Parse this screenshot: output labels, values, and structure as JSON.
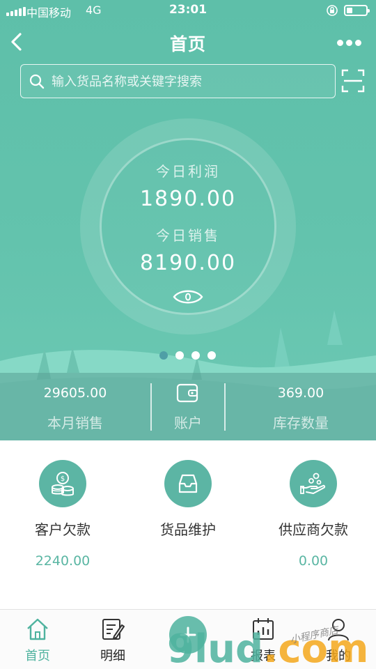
{
  "status_bar": {
    "carrier": "中国移动",
    "network": "4G",
    "time": "23:01",
    "battery_level": 0.3
  },
  "nav": {
    "title": "首页",
    "back_icon": "chevron-left-icon",
    "more_icon": "more-dots-icon"
  },
  "search": {
    "placeholder": "输入货品名称或关键字搜索",
    "scan_icon": "scan-icon"
  },
  "hero": {
    "profit_label": "今日利润",
    "profit_value": "1890.00",
    "sales_label": "今日销售",
    "sales_value": "8190.00",
    "visibility_icon": "eye-icon",
    "carousel": {
      "count": 4,
      "active_index": 0
    }
  },
  "summary": {
    "monthly_sales_value": "29605.00",
    "monthly_sales_label": "本月销售",
    "account_label": "账户",
    "stock_value": "369.00",
    "stock_label": "库存数量"
  },
  "actions": [
    {
      "label": "客户欠款",
      "amount": "2240.00",
      "icon": "coins-icon"
    },
    {
      "label": "货品维护",
      "amount": "",
      "icon": "inbox-icon"
    },
    {
      "label": "供应商欠款",
      "amount": "0.00",
      "icon": "hand-coins-icon"
    }
  ],
  "tabbar": {
    "items": [
      {
        "label": "首页",
        "icon": "home-icon",
        "active": true
      },
      {
        "label": "明细",
        "icon": "edit-list-icon",
        "active": false
      },
      {
        "label": "",
        "icon": "add-icon",
        "active": false
      },
      {
        "label": "报表",
        "icon": "calendar-chart-icon",
        "active": false
      },
      {
        "label": "我的",
        "icon": "user-icon",
        "active": false
      }
    ]
  },
  "watermark": {
    "text": "9lud.com",
    "subtext": "小程序商店"
  },
  "colors": {
    "primary": "#5ebfa9",
    "accent": "#4fb39f",
    "amount_text": "#5ab6a3",
    "active_dot": "#4f9fa6",
    "watermark": "#f4a81c"
  }
}
